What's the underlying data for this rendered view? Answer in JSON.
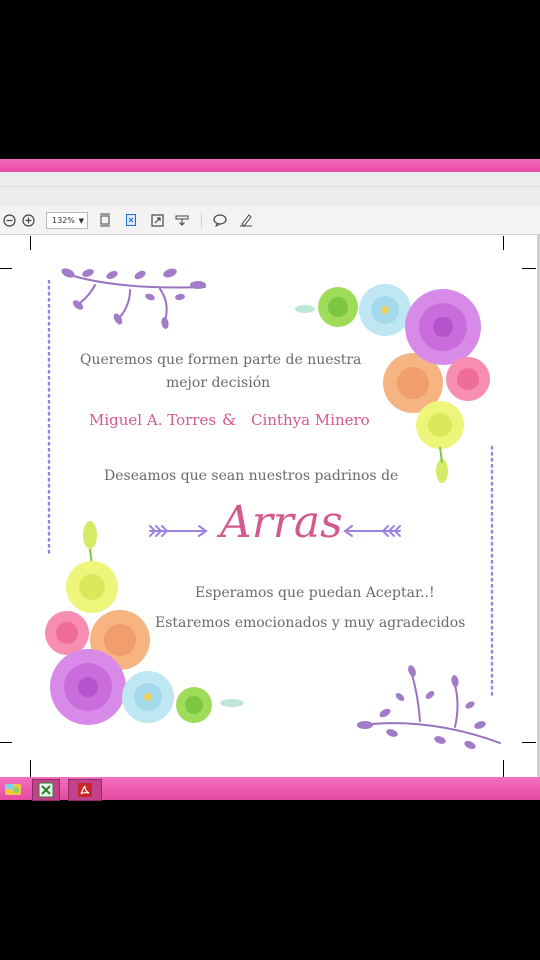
{
  "toolbar": {
    "zoom_value": "132%",
    "icons": [
      "zoom-out-icon",
      "zoom-in-icon",
      "fit-page-icon",
      "fit-width-icon",
      "fullscreen-icon",
      "print-icon",
      "comment-icon",
      "sign-icon"
    ]
  },
  "invitation": {
    "line1": "Queremos que formen parte de nuestra",
    "line2": "mejor decisión",
    "name1": "Miguel A. Torres",
    "ampersand": "&",
    "name2": "Cinthya Minero",
    "line3": "Deseamos que sean nuestros padrinos de",
    "title": "Arras",
    "line4": "Esperamos que puedan Aceptar..!",
    "line5": "Estaremos emocionados y muy agradecidos"
  },
  "colors": {
    "pink_bar": "#ec5bb1",
    "accent_pink": "#d45a8e",
    "lavender": "#9b84e0",
    "text_gray": "#6a6a6a"
  },
  "taskbar": {
    "apps": [
      "photos-icon",
      "excel-icon",
      "acrobat-icon"
    ]
  }
}
